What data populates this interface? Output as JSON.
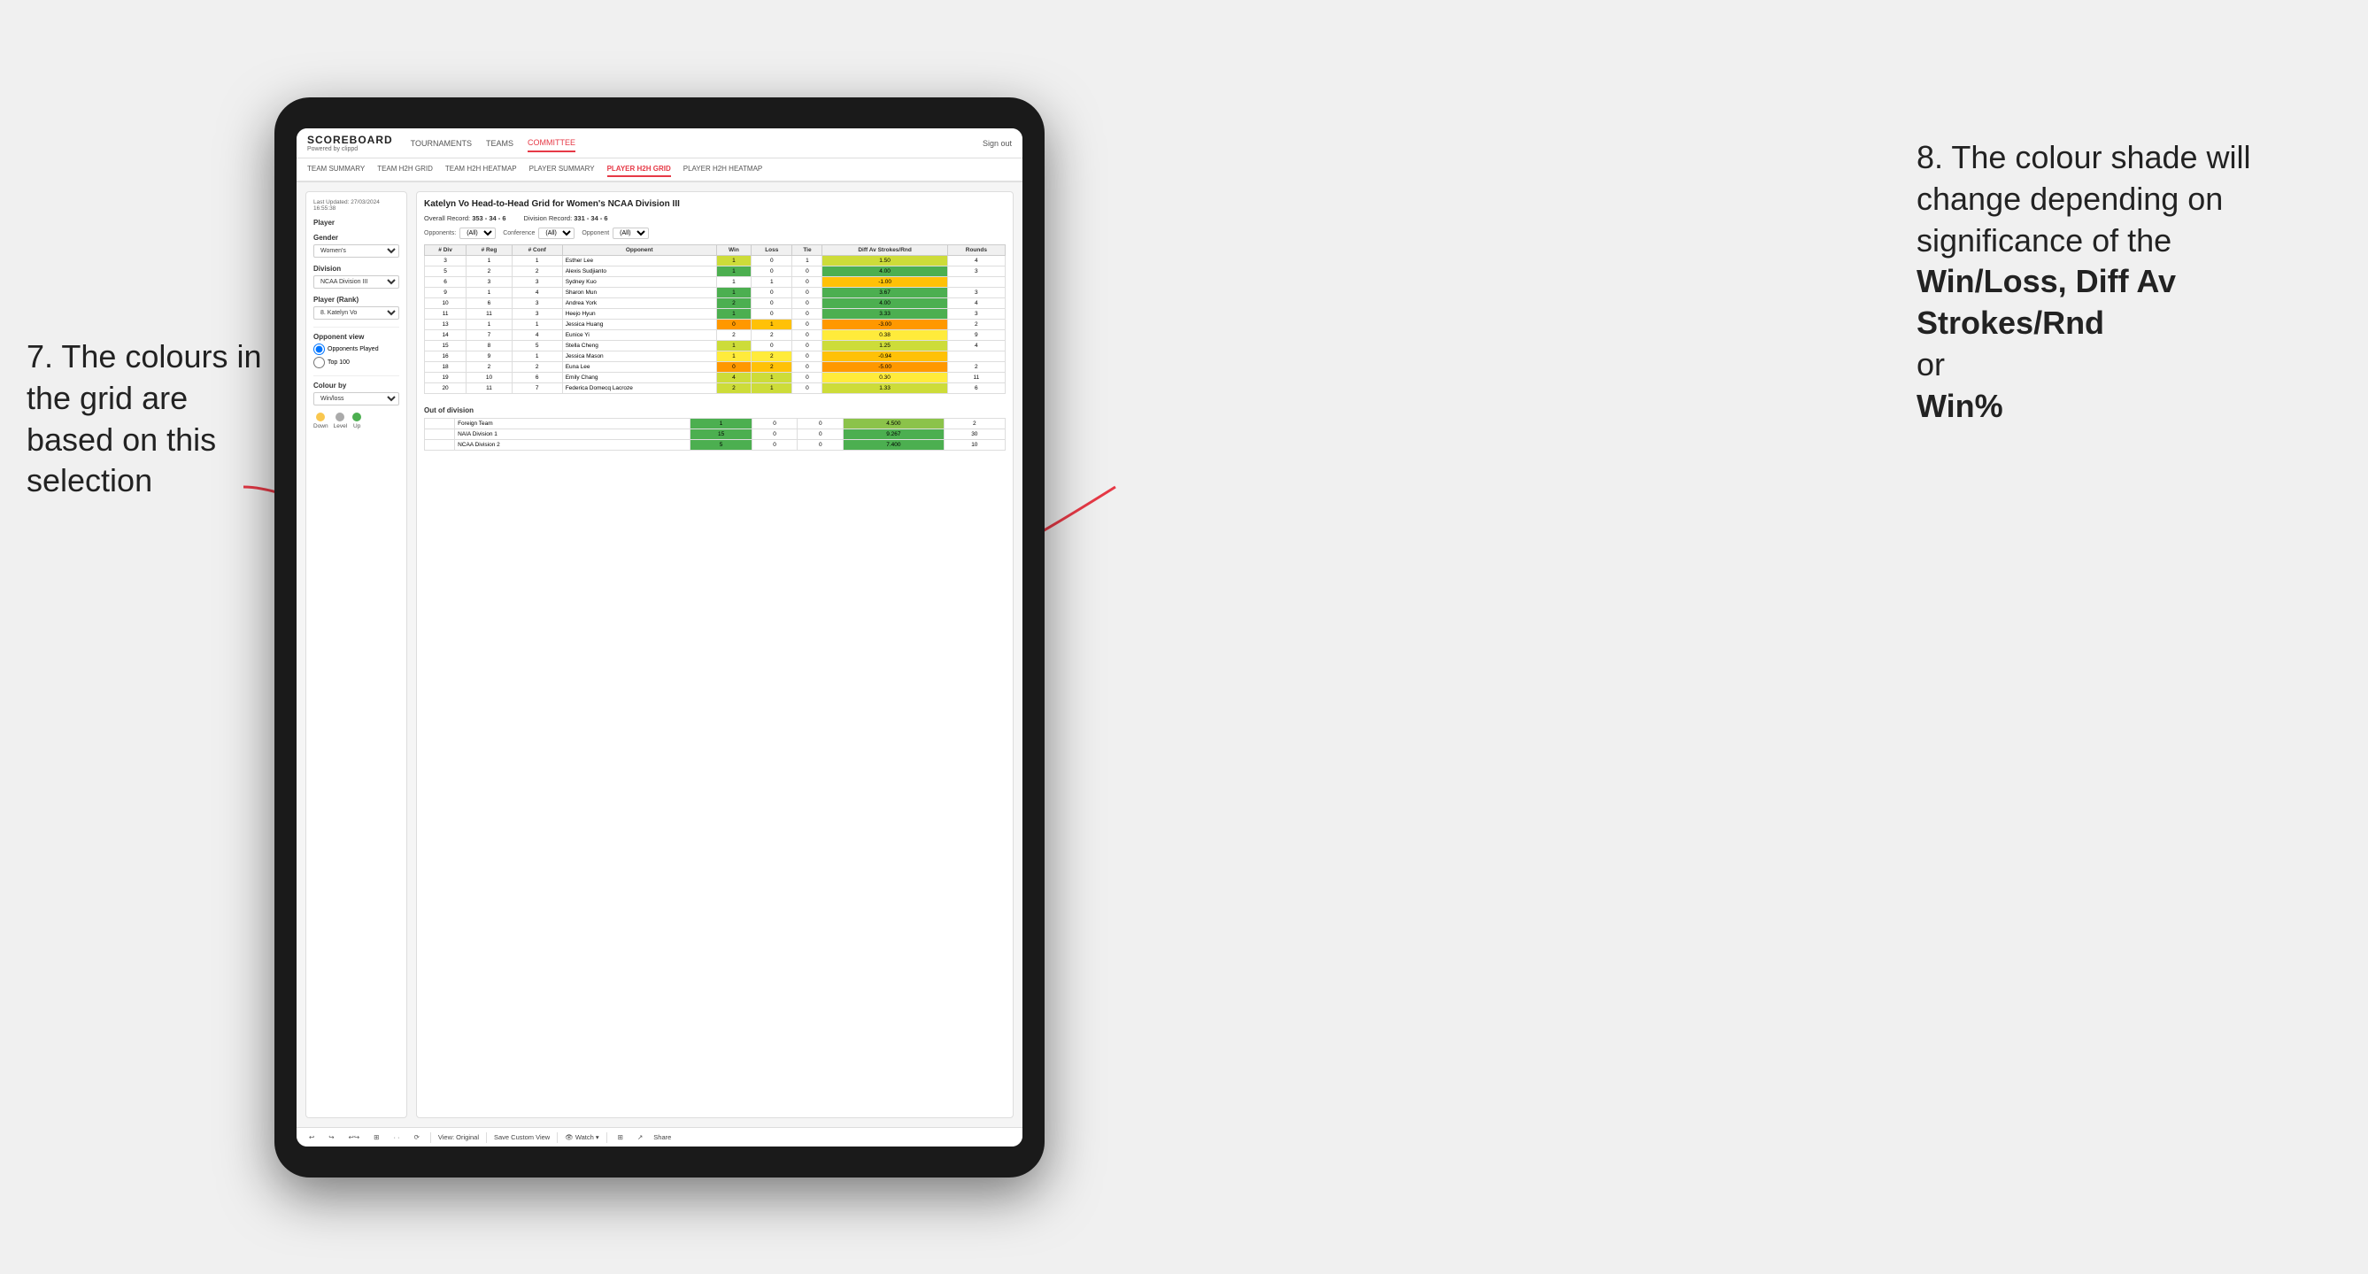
{
  "annotations": {
    "left_title": "7. The colours in the grid are based on this selection",
    "right_title": "8. The colour shade will change depending on significance of the",
    "right_bold": "Win/Loss, Diff Av Strokes/Rnd",
    "right_suffix": "or",
    "right_bold2": "Win%"
  },
  "app": {
    "logo": "SCOREBOARD",
    "logo_sub": "Powered by clippd",
    "nav": [
      "TOURNAMENTS",
      "TEAMS",
      "COMMITTEE"
    ],
    "active_nav": "COMMITTEE",
    "header_right": "Sign out",
    "sub_nav": [
      "TEAM SUMMARY",
      "TEAM H2H GRID",
      "TEAM H2H HEATMAP",
      "PLAYER SUMMARY",
      "PLAYER H2H GRID",
      "PLAYER H2H HEATMAP"
    ],
    "active_sub_nav": "PLAYER H2H GRID"
  },
  "sidebar": {
    "timestamp": "Last Updated: 27/03/2024 16:55:38",
    "player_label": "Player",
    "gender_label": "Gender",
    "gender_value": "Women's",
    "division_label": "Division",
    "division_value": "NCAA Division III",
    "player_rank_label": "Player (Rank)",
    "player_rank_value": "8. Katelyn Vo",
    "opponent_view_label": "Opponent view",
    "radio1": "Opponents Played",
    "radio2": "Top 100",
    "colour_by_label": "Colour by",
    "colour_by_value": "Win/loss",
    "legend": {
      "down_label": "Down",
      "level_label": "Level",
      "up_label": "Up",
      "down_color": "#f9c74f",
      "level_color": "#aaaaaa",
      "up_color": "#4caf50"
    }
  },
  "grid": {
    "title": "Katelyn Vo Head-to-Head Grid for Women's NCAA Division III",
    "overall_record": "353 - 34 - 6",
    "division_record": "331 - 34 - 6",
    "filter_opponents_label": "Opponents:",
    "filter_opponents_value": "(All)",
    "filter_conference_label": "Conference",
    "filter_conference_value": "(All)",
    "filter_opponent_label": "Opponent",
    "filter_opponent_value": "(All)",
    "columns": [
      "# Div",
      "# Reg",
      "# Conf",
      "Opponent",
      "Win",
      "Loss",
      "Tie",
      "Diff Av Strokes/Rnd",
      "Rounds"
    ],
    "rows": [
      {
        "div": 3,
        "reg": 1,
        "conf": 1,
        "opponent": "Esther Lee",
        "win": 1,
        "loss": 0,
        "tie": 1,
        "diff": 1.5,
        "rounds": 4,
        "win_color": "",
        "loss_color": ""
      },
      {
        "div": 5,
        "reg": 2,
        "conf": 2,
        "opponent": "Alexis Sudjianto",
        "win": 1,
        "loss": 0,
        "tie": 0,
        "diff": 4.0,
        "rounds": 3,
        "win_color": "win",
        "loss_color": ""
      },
      {
        "div": 6,
        "reg": 3,
        "conf": 3,
        "opponent": "Sydney Kuo",
        "win": 1,
        "loss": 1,
        "tie": 0,
        "diff": -1.0,
        "rounds": "",
        "win_color": "loss",
        "loss_color": "loss"
      },
      {
        "div": 9,
        "reg": 1,
        "conf": 4,
        "opponent": "Sharon Mun",
        "win": 1,
        "loss": 0,
        "tie": 0,
        "diff": 3.67,
        "rounds": 3,
        "win_color": "win",
        "loss_color": ""
      },
      {
        "div": 10,
        "reg": 6,
        "conf": 3,
        "opponent": "Andrea York",
        "win": 2,
        "loss": 0,
        "tie": 0,
        "diff": 4.0,
        "rounds": 4,
        "win_color": "win",
        "loss_color": ""
      },
      {
        "div": 11,
        "reg": 11,
        "conf": 3,
        "opponent": "Heejo Hyun",
        "win": 1,
        "loss": 0,
        "tie": 0,
        "diff": 3.33,
        "rounds": 3,
        "win_color": "win",
        "loss_color": ""
      },
      {
        "div": 13,
        "reg": 1,
        "conf": 1,
        "opponent": "Jessica Huang",
        "win": 0,
        "loss": 1,
        "tie": 0,
        "diff": -3.0,
        "rounds": 2,
        "win_color": "loss",
        "loss_color": "loss"
      },
      {
        "div": 14,
        "reg": 7,
        "conf": 4,
        "opponent": "Eunice Yi",
        "win": 2,
        "loss": 2,
        "tie": 0,
        "diff": 0.38,
        "rounds": 9,
        "win_color": "neutral",
        "loss_color": "neutral"
      },
      {
        "div": 15,
        "reg": 8,
        "conf": 5,
        "opponent": "Stella Cheng",
        "win": 1,
        "loss": 0,
        "tie": 0,
        "diff": 1.25,
        "rounds": 4,
        "win_color": "win_light",
        "loss_color": ""
      },
      {
        "div": 16,
        "reg": 9,
        "conf": 1,
        "opponent": "Jessica Mason",
        "win": 1,
        "loss": 2,
        "tie": 0,
        "diff": -0.94,
        "rounds": "",
        "win_color": "loss_light",
        "loss_color": "loss_light"
      },
      {
        "div": 18,
        "reg": 2,
        "conf": 2,
        "opponent": "Euna Lee",
        "win": 0,
        "loss": 2,
        "tie": 0,
        "diff": -5.0,
        "rounds": 2,
        "win_color": "loss",
        "loss_color": "loss"
      },
      {
        "div": 19,
        "reg": 10,
        "conf": 6,
        "opponent": "Emily Chang",
        "win": 4,
        "loss": 1,
        "tie": 0,
        "diff": 0.3,
        "rounds": 11,
        "win_color": "win_light",
        "loss_color": ""
      },
      {
        "div": 20,
        "reg": 11,
        "conf": 7,
        "opponent": "Federica Domecq Lacroze",
        "win": 2,
        "loss": 1,
        "tie": 0,
        "diff": 1.33,
        "rounds": 6,
        "win_color": "win_light",
        "loss_color": ""
      }
    ],
    "out_of_division_title": "Out of division",
    "out_rows": [
      {
        "opponent": "Foreign Team",
        "win": 1,
        "loss": 0,
        "tie": 0,
        "diff": 4.5,
        "rounds": 2
      },
      {
        "opponent": "NAIA Division 1",
        "win": 15,
        "loss": 0,
        "tie": 0,
        "diff": 9.267,
        "rounds": 30
      },
      {
        "opponent": "NCAA Division 2",
        "win": 5,
        "loss": 0,
        "tie": 0,
        "diff": 7.4,
        "rounds": 10
      }
    ]
  },
  "toolbar": {
    "items": [
      "↩",
      "↪",
      "↩↪",
      "⊞",
      "↶ ·",
      "⟳",
      "|",
      "View: Original",
      "|",
      "Save Custom View",
      "|",
      "👁 Watch ▾",
      "|",
      "⊞",
      "↗",
      "Share"
    ]
  }
}
